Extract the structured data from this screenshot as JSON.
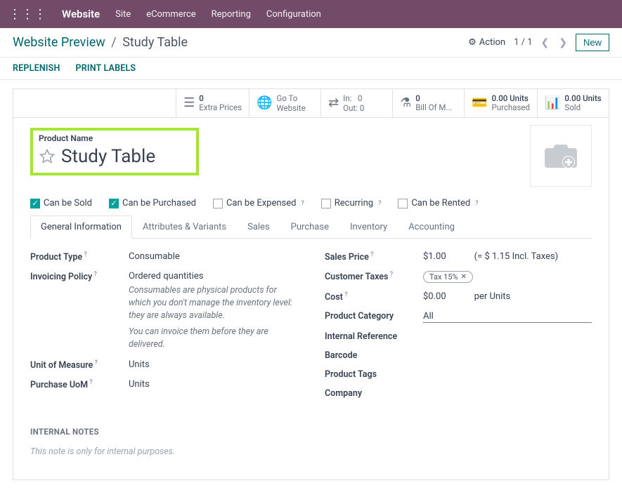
{
  "nav": {
    "brand": "Website",
    "items": [
      "Site",
      "eCommerce",
      "Reporting",
      "Configuration"
    ]
  },
  "breadcrumb": {
    "parent": "Website Preview",
    "sep": "/",
    "current": "Study Table"
  },
  "header_actions": {
    "action": "Action",
    "pager": "1 / 1",
    "new": "New"
  },
  "subactions": {
    "replenish": "REPLENISH",
    "print_labels": "PRINT LABELS"
  },
  "stats": {
    "extra_prices": {
      "count": "0",
      "label": "Extra Prices"
    },
    "goto_website": {
      "line1": "Go To",
      "line2": "Website"
    },
    "in_out": {
      "in_label": "In:",
      "in_val": "0",
      "out_label": "Out:",
      "out_val": "0"
    },
    "bom": {
      "count": "0",
      "label": "Bill Of M..."
    },
    "purchased": {
      "value": "0.00 Units",
      "label": "Purchased"
    },
    "sold": {
      "value": "0.00 Units",
      "label": "Sold"
    }
  },
  "product": {
    "name_label": "Product Name",
    "name": "Study Table"
  },
  "flags": {
    "sold": "Can be Sold",
    "purchased": "Can be Purchased",
    "expensed": "Can be Expensed",
    "recurring": "Recurring",
    "rented": "Can be Rented"
  },
  "tabs": {
    "general": "General Information",
    "attrs": "Attributes & Variants",
    "sales": "Sales",
    "purchase": "Purchase",
    "inventory": "Inventory",
    "accounting": "Accounting"
  },
  "fields": {
    "product_type": {
      "label": "Product Type",
      "value": "Consumable"
    },
    "invoicing_policy": {
      "label": "Invoicing Policy",
      "value": "Ordered quantities",
      "help1": "Consumables are physical products for which you don't manage the inventory level: they are always available.",
      "help2": "You can invoice them before they are delivered."
    },
    "uom": {
      "label": "Unit of Measure",
      "value": "Units"
    },
    "purchase_uom": {
      "label": "Purchase UoM",
      "value": "Units"
    },
    "sales_price": {
      "label": "Sales Price",
      "value": "$1.00",
      "incl": "(= $ 1.15 Incl. Taxes)"
    },
    "customer_taxes": {
      "label": "Customer Taxes",
      "tag": "Tax 15%"
    },
    "cost": {
      "label": "Cost",
      "value": "$0.00",
      "unit": "per Units"
    },
    "category": {
      "label": "Product Category",
      "value": "All"
    },
    "internal_ref": {
      "label": "Internal Reference"
    },
    "barcode": {
      "label": "Barcode"
    },
    "tags": {
      "label": "Product Tags"
    },
    "company": {
      "label": "Company"
    }
  },
  "notes": {
    "heading": "INTERNAL NOTES",
    "placeholder": "This note is only for internal purposes."
  }
}
